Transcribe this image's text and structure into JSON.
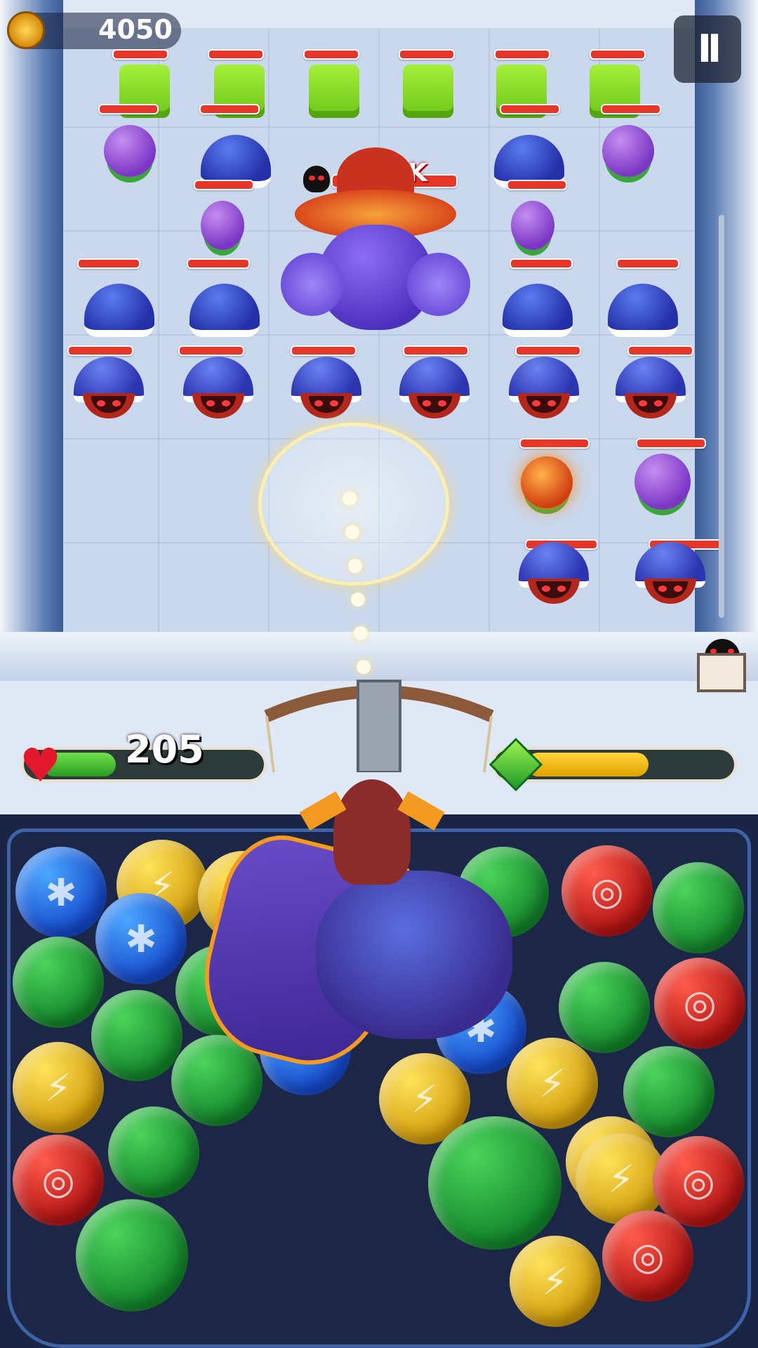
{
  "hud": {
    "coins": "4050",
    "coin_icon": "gold-coin-icon",
    "pause_label": "II",
    "boss_hp": "235K",
    "player_hp": "205",
    "player_hp_fraction": 0.35,
    "energy_fraction": 0.6,
    "heart_icon": "heart-icon",
    "energy_icon": "green-gem-icon"
  },
  "enemies": {
    "row1": [
      "green-cube-enemy",
      "green-cube-enemy",
      "green-cube-enemy",
      "green-cube-enemy",
      "green-cube-enemy",
      "green-cube-enemy"
    ],
    "row2": [
      "purple-plant-enemy",
      "blue-shell-enemy",
      "boss",
      "boss",
      "blue-shell-enemy",
      "purple-plant-enemy"
    ],
    "row3": [
      "purple-plant-enemy",
      "purple-plant-enemy"
    ],
    "row4": [
      "blue-shell-enemy",
      "blue-shell-enemy",
      "blue-shell-enemy",
      "blue-shell-enemy"
    ],
    "row5": [
      "hermit-crab-enemy",
      "hermit-crab-enemy",
      "hermit-crab-enemy",
      "hermit-crab-enemy",
      "hermit-crab-enemy",
      "hermit-crab-enemy"
    ],
    "row6": [
      "fire-plant-enemy",
      "purple-plant-enemy"
    ],
    "row7": [
      "hermit-crab-enemy",
      "hermit-crab-enemy"
    ]
  },
  "orbs": [
    "blue",
    "yellow",
    "yellow",
    "green",
    "red",
    "green",
    "blue",
    "green",
    "green",
    "red",
    "green",
    "green",
    "blue",
    "blue",
    "yellow",
    "yellow",
    "green",
    "yellow",
    "green",
    "yellow",
    "red",
    "green",
    "green",
    "yellow",
    "red",
    "green",
    "yellow",
    "red"
  ],
  "colors": {
    "green": "#1f9a2a",
    "blue": "#1549cc",
    "yellow": "#d19c0a",
    "red": "#b01313",
    "boss": "#4b2fbd"
  }
}
